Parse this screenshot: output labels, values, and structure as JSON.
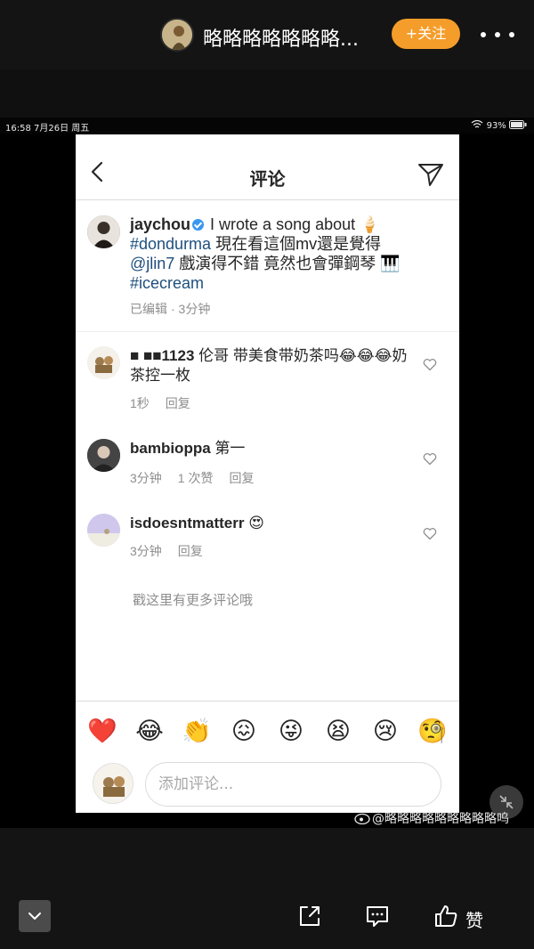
{
  "viewer": {
    "title": "略略略略略略略...",
    "follow_label": "+关注",
    "watermark": "@略略略略略略略略略呜",
    "like_label": "赞"
  },
  "status_bar": {
    "time_date": "16:58  7月26日 周五",
    "right": "93%"
  },
  "page": {
    "title": "评论",
    "post": {
      "username": "jaychou",
      "line1": " I wrote a song about 🍦",
      "tag1": "#dondurma",
      "line2": "  現在看這個mv還是覺得",
      "mention": "@jlin7",
      "line3": " 戲演得不錯 竟然也會彈鋼琴 🎹",
      "tag2": "#icecream",
      "edited": "已编辑",
      "time": "· 3分钟"
    },
    "comments": [
      {
        "username": "■ ■■1123",
        "text": " 伦哥 带美食带奶茶吗😂😂😂奶茶控一枚",
        "time": "1秒",
        "likes": "",
        "reply": "回复"
      },
      {
        "username": "bambioppa",
        "text": " 第一",
        "time": "3分钟",
        "likes": "1 次赞",
        "reply": "回复"
      },
      {
        "username": "isdoesntmatterr",
        "text": " 😍",
        "time": "3分钟",
        "likes": "",
        "reply": "回复"
      }
    ],
    "more_comments": "戳这里有更多评论哦",
    "emojis": [
      "❤️",
      "😂",
      "👏",
      "😖",
      "😜",
      "😫",
      "😢",
      "🧐"
    ],
    "input_placeholder": "添加评论..."
  },
  "icons": {
    "back": "chevron-left-icon",
    "send": "paper-plane-icon",
    "more": "more-dots-icon",
    "share": "share-icon",
    "comment": "comment-icon",
    "like": "thumbs-up-icon"
  }
}
